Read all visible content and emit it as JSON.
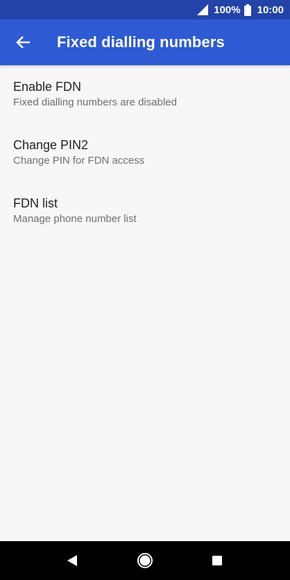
{
  "status_bar": {
    "battery_percent": "100%",
    "time": "10:00",
    "icons": [
      "signal-icon",
      "battery-icon"
    ]
  },
  "app_bar": {
    "title": "Fixed dialling numbers",
    "back_icon": "arrow-left-icon",
    "color": "#2e5bd3"
  },
  "settings": {
    "items": [
      {
        "title": "Enable FDN",
        "subtitle": "Fixed dialling numbers are disabled"
      },
      {
        "title": "Change PIN2",
        "subtitle": "Change PIN for FDN access"
      },
      {
        "title": "FDN list",
        "subtitle": "Manage phone number list"
      }
    ]
  },
  "nav_bar": {
    "buttons": [
      "back-triangle-icon",
      "home-circle-icon",
      "recents-square-icon"
    ]
  }
}
